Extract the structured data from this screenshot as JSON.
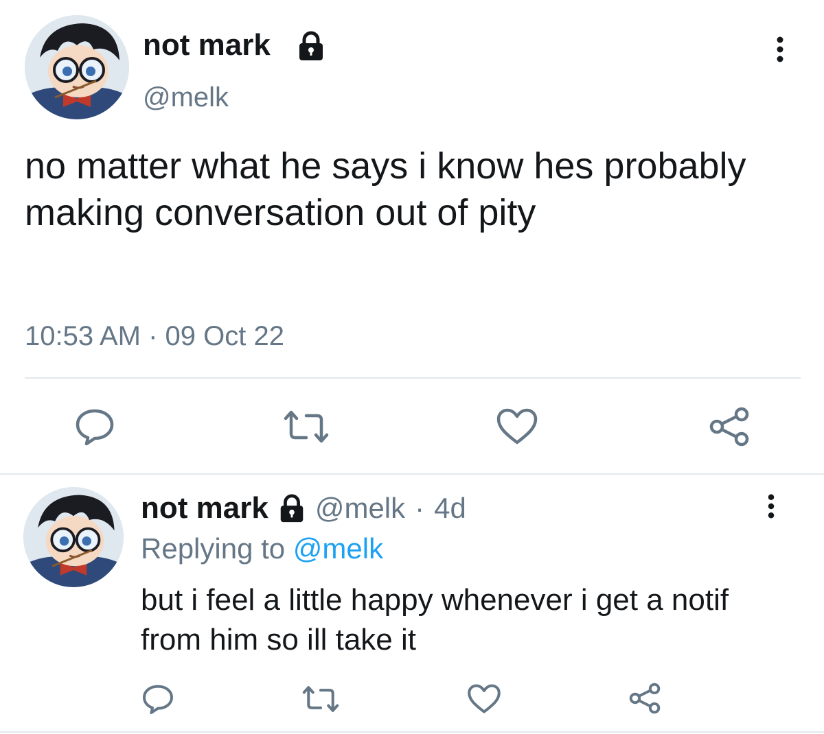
{
  "main_tweet": {
    "display_name": "not mark",
    "handle": "@melk",
    "text": "no matter what he says i know hes probably making conversation out of pity",
    "timestamp": "10:53 AM · 09 Oct 22",
    "icons": {
      "lock": "lock-icon",
      "more": "more-options-icon",
      "reply": "reply-icon",
      "retweet": "retweet-icon",
      "like": "heart-icon",
      "share": "share-icon"
    }
  },
  "reply_tweet": {
    "display_name": "not mark",
    "handle": "@melk",
    "separator": "·",
    "age": "4d",
    "replying_prefix": "Replying to",
    "replying_handle": "@melk",
    "text": "but i feel a little happy whenever i get a notif from him so ill take it"
  },
  "colors": {
    "primary_text": "#14171a",
    "secondary_text": "#657786",
    "link": "#1da1f2",
    "divider": "#e1e8ed",
    "icon": "#657786"
  }
}
